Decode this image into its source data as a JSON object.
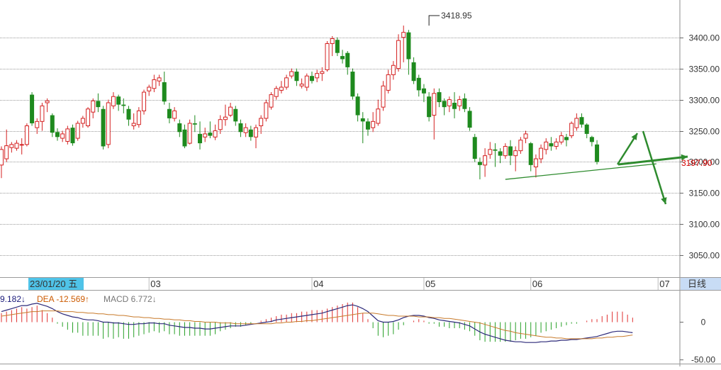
{
  "chart_data": {
    "type": "candlestick",
    "y_axis": {
      "ylim": [
        3015,
        3460
      ],
      "ticks": [
        3050,
        3100,
        3150,
        3200,
        3250,
        3300,
        3350,
        3400
      ],
      "tick_labels": [
        "3050.00",
        "3100.00",
        "3150.00",
        "3200.00",
        "3250.00",
        "3300.00",
        "3350.00",
        "3400.00"
      ]
    },
    "x_axis": {
      "labels": [
        {
          "text": "03",
          "bar": 29
        },
        {
          "text": "04",
          "bar": 61
        },
        {
          "text": "05",
          "bar": 83
        },
        {
          "text": "06",
          "bar": 104
        },
        {
          "text": "07",
          "bar": 129
        }
      ],
      "selected_date": "23/01/20 五",
      "period_label": "日线"
    },
    "annotations": {
      "high_label": "3418.95",
      "high_value": 3418.95,
      "high_bar": 84,
      "current_price": "3197.90",
      "current_value": 3197.9
    },
    "candles": [
      {
        "o": 3195,
        "c": 3220,
        "h": 3225,
        "l": 3174
      },
      {
        "o": 3205,
        "c": 3226,
        "h": 3252,
        "l": 3200
      },
      {
        "o": 3223,
        "c": 3228,
        "h": 3232,
        "l": 3215
      },
      {
        "o": 3222,
        "c": 3230,
        "h": 3235,
        "l": 3218
      },
      {
        "o": 3228,
        "c": 3228,
        "h": 3238,
        "l": 3212
      },
      {
        "o": 3228,
        "c": 3258,
        "h": 3262,
        "l": 3225
      },
      {
        "o": 3308,
        "c": 3262,
        "h": 3312,
        "l": 3258
      },
      {
        "o": 3255,
        "c": 3265,
        "h": 3270,
        "l": 3245
      },
      {
        "o": 3265,
        "c": 3290,
        "h": 3295,
        "l": 3250
      },
      {
        "o": 3295,
        "c": 3298,
        "h": 3302,
        "l": 3280
      },
      {
        "o": 3275,
        "c": 3247,
        "h": 3278,
        "l": 3240
      },
      {
        "o": 3248,
        "c": 3240,
        "h": 3254,
        "l": 3234
      },
      {
        "o": 3238,
        "c": 3245,
        "h": 3250,
        "l": 3232
      },
      {
        "o": 3233,
        "c": 3253,
        "h": 3258,
        "l": 3228
      },
      {
        "o": 3255,
        "c": 3230,
        "h": 3260,
        "l": 3226
      },
      {
        "o": 3238,
        "c": 3262,
        "h": 3266,
        "l": 3234
      },
      {
        "o": 3262,
        "c": 3270,
        "h": 3274,
        "l": 3255
      },
      {
        "o": 3258,
        "c": 3285,
        "h": 3288,
        "l": 3255
      },
      {
        "o": 3280,
        "c": 3298,
        "h": 3302,
        "l": 3270
      },
      {
        "o": 3298,
        "c": 3288,
        "h": 3310,
        "l": 3280
      },
      {
        "o": 3285,
        "c": 3225,
        "h": 3290,
        "l": 3220
      },
      {
        "o": 3228,
        "c": 3295,
        "h": 3300,
        "l": 3222
      },
      {
        "o": 3290,
        "c": 3305,
        "h": 3312,
        "l": 3285
      },
      {
        "o": 3305,
        "c": 3292,
        "h": 3308,
        "l": 3282
      },
      {
        "o": 3292,
        "c": 3290,
        "h": 3302,
        "l": 3278
      },
      {
        "o": 3285,
        "c": 3268,
        "h": 3290,
        "l": 3258
      },
      {
        "o": 3258,
        "c": 3262,
        "h": 3278,
        "l": 3252
      },
      {
        "o": 3260,
        "c": 3282,
        "h": 3288,
        "l": 3255
      },
      {
        "o": 3282,
        "c": 3312,
        "h": 3316,
        "l": 3276
      },
      {
        "o": 3314,
        "c": 3320,
        "h": 3324,
        "l": 3306
      },
      {
        "o": 3318,
        "c": 3332,
        "h": 3340,
        "l": 3312
      },
      {
        "o": 3330,
        "c": 3335,
        "h": 3340,
        "l": 3322
      },
      {
        "o": 3328,
        "c": 3297,
        "h": 3345,
        "l": 3292
      },
      {
        "o": 3285,
        "c": 3270,
        "h": 3295,
        "l": 3262
      },
      {
        "o": 3270,
        "c": 3282,
        "h": 3288,
        "l": 3265
      },
      {
        "o": 3262,
        "c": 3248,
        "h": 3268,
        "l": 3240
      },
      {
        "o": 3252,
        "c": 3225,
        "h": 3260,
        "l": 3222
      },
      {
        "o": 3230,
        "c": 3262,
        "h": 3268,
        "l": 3228
      },
      {
        "o": 3262,
        "c": 3260,
        "h": 3275,
        "l": 3248
      },
      {
        "o": 3245,
        "c": 3230,
        "h": 3265,
        "l": 3220
      },
      {
        "o": 3240,
        "c": 3245,
        "h": 3255,
        "l": 3232
      },
      {
        "o": 3247,
        "c": 3242,
        "h": 3265,
        "l": 3238
      },
      {
        "o": 3240,
        "c": 3250,
        "h": 3260,
        "l": 3235
      },
      {
        "o": 3252,
        "c": 3268,
        "h": 3275,
        "l": 3245
      },
      {
        "o": 3268,
        "c": 3272,
        "h": 3292,
        "l": 3258
      },
      {
        "o": 3275,
        "c": 3288,
        "h": 3295,
        "l": 3272
      },
      {
        "o": 3285,
        "c": 3265,
        "h": 3290,
        "l": 3258
      },
      {
        "o": 3262,
        "c": 3248,
        "h": 3268,
        "l": 3240
      },
      {
        "o": 3247,
        "c": 3255,
        "h": 3262,
        "l": 3240
      },
      {
        "o": 3252,
        "c": 3240,
        "h": 3258,
        "l": 3234
      },
      {
        "o": 3240,
        "c": 3255,
        "h": 3260,
        "l": 3222
      },
      {
        "o": 3258,
        "c": 3270,
        "h": 3275,
        "l": 3245
      },
      {
        "o": 3270,
        "c": 3295,
        "h": 3300,
        "l": 3265
      },
      {
        "o": 3288,
        "c": 3308,
        "h": 3312,
        "l": 3284
      },
      {
        "o": 3305,
        "c": 3318,
        "h": 3322,
        "l": 3300
      },
      {
        "o": 3315,
        "c": 3320,
        "h": 3330,
        "l": 3310
      },
      {
        "o": 3320,
        "c": 3335,
        "h": 3340,
        "l": 3316
      },
      {
        "o": 3338,
        "c": 3345,
        "h": 3350,
        "l": 3334
      },
      {
        "o": 3345,
        "c": 3330,
        "h": 3350,
        "l": 3322
      },
      {
        "o": 3322,
        "c": 3325,
        "h": 3334,
        "l": 3318
      },
      {
        "o": 3320,
        "c": 3338,
        "h": 3342,
        "l": 3314
      },
      {
        "o": 3338,
        "c": 3330,
        "h": 3345,
        "l": 3326
      },
      {
        "o": 3335,
        "c": 3342,
        "h": 3348,
        "l": 3328
      },
      {
        "o": 3342,
        "c": 3345,
        "h": 3352,
        "l": 3330
      },
      {
        "o": 3348,
        "c": 3390,
        "h": 3394,
        "l": 3345
      },
      {
        "o": 3390,
        "c": 3398,
        "h": 3402,
        "l": 3370
      },
      {
        "o": 3396,
        "c": 3375,
        "h": 3400,
        "l": 3370
      },
      {
        "o": 3370,
        "c": 3365,
        "h": 3380,
        "l": 3358
      },
      {
        "o": 3375,
        "c": 3352,
        "h": 3378,
        "l": 3340
      },
      {
        "o": 3345,
        "c": 3305,
        "h": 3350,
        "l": 3300
      },
      {
        "o": 3305,
        "c": 3275,
        "h": 3310,
        "l": 3265
      },
      {
        "o": 3270,
        "c": 3265,
        "h": 3280,
        "l": 3230
      },
      {
        "o": 3265,
        "c": 3252,
        "h": 3270,
        "l": 3242
      },
      {
        "o": 3255,
        "c": 3265,
        "h": 3280,
        "l": 3248
      },
      {
        "o": 3262,
        "c": 3285,
        "h": 3300,
        "l": 3258
      },
      {
        "o": 3288,
        "c": 3322,
        "h": 3330,
        "l": 3282
      },
      {
        "o": 3315,
        "c": 3340,
        "h": 3348,
        "l": 3310
      },
      {
        "o": 3340,
        "c": 3355,
        "h": 3362,
        "l": 3332
      },
      {
        "o": 3350,
        "c": 3395,
        "h": 3405,
        "l": 3345
      },
      {
        "o": 3400,
        "c": 3408,
        "h": 3418.95,
        "l": 3360
      },
      {
        "o": 3408,
        "c": 3365,
        "h": 3412,
        "l": 3340
      },
      {
        "o": 3360,
        "c": 3330,
        "h": 3368,
        "l": 3325
      },
      {
        "o": 3335,
        "c": 3315,
        "h": 3340,
        "l": 3305
      },
      {
        "o": 3318,
        "c": 3310,
        "h": 3325,
        "l": 3296
      },
      {
        "o": 3305,
        "c": 3272,
        "h": 3312,
        "l": 3265
      },
      {
        "o": 3275,
        "c": 3310,
        "h": 3318,
        "l": 3236
      },
      {
        "o": 3312,
        "c": 3296,
        "h": 3318,
        "l": 3288
      },
      {
        "o": 3298,
        "c": 3288,
        "h": 3302,
        "l": 3275
      },
      {
        "o": 3290,
        "c": 3300,
        "h": 3305,
        "l": 3280
      },
      {
        "o": 3295,
        "c": 3285,
        "h": 3312,
        "l": 3270
      },
      {
        "o": 3290,
        "c": 3300,
        "h": 3306,
        "l": 3282
      },
      {
        "o": 3302,
        "c": 3285,
        "h": 3310,
        "l": 3280
      },
      {
        "o": 3282,
        "c": 3255,
        "h": 3288,
        "l": 3250
      },
      {
        "o": 3240,
        "c": 3205,
        "h": 3245,
        "l": 3200
      },
      {
        "o": 3200,
        "c": 3195,
        "h": 3207,
        "l": 3172
      },
      {
        "o": 3195,
        "c": 3210,
        "h": 3222,
        "l": 3176
      },
      {
        "o": 3212,
        "c": 3220,
        "h": 3232,
        "l": 3205
      },
      {
        "o": 3220,
        "c": 3218,
        "h": 3230,
        "l": 3192
      },
      {
        "o": 3217,
        "c": 3210,
        "h": 3222,
        "l": 3198
      },
      {
        "o": 3210,
        "c": 3225,
        "h": 3230,
        "l": 3205
      },
      {
        "o": 3225,
        "c": 3210,
        "h": 3235,
        "l": 3195
      },
      {
        "o": 3210,
        "c": 3218,
        "h": 3225,
        "l": 3185
      },
      {
        "o": 3218,
        "c": 3235,
        "h": 3240,
        "l": 3213
      },
      {
        "o": 3238,
        "c": 3245,
        "h": 3250,
        "l": 3230
      },
      {
        "o": 3230,
        "c": 3195,
        "h": 3232,
        "l": 3185
      },
      {
        "o": 3192,
        "c": 3205,
        "h": 3212,
        "l": 3175
      },
      {
        "o": 3205,
        "c": 3222,
        "h": 3228,
        "l": 3198
      },
      {
        "o": 3220,
        "c": 3232,
        "h": 3238,
        "l": 3212
      },
      {
        "o": 3230,
        "c": 3225,
        "h": 3240,
        "l": 3218
      },
      {
        "o": 3225,
        "c": 3232,
        "h": 3238,
        "l": 3220
      },
      {
        "o": 3232,
        "c": 3242,
        "h": 3248,
        "l": 3228
      },
      {
        "o": 3240,
        "c": 3235,
        "h": 3245,
        "l": 3225
      },
      {
        "o": 3242,
        "c": 3262,
        "h": 3265,
        "l": 3238
      },
      {
        "o": 3255,
        "c": 3270,
        "h": 3278,
        "l": 3250
      },
      {
        "o": 3272,
        "c": 3260,
        "h": 3278,
        "l": 3255
      },
      {
        "o": 3260,
        "c": 3245,
        "h": 3262,
        "l": 3238
      },
      {
        "o": 3240,
        "c": 3232,
        "h": 3242,
        "l": 3225
      },
      {
        "o": 3228,
        "c": 3200,
        "h": 3235,
        "l": 3196
      }
    ],
    "trendline": {
      "from": [
        99,
        3172
      ],
      "to": [
        127,
        3197
      ]
    },
    "macd": {
      "legend": {
        "dif": "9.182↓",
        "dea": "DEA -12.569↑",
        "macd": "MACD 6.772↓"
      },
      "ylim": [
        -55,
        40
      ],
      "ticks": [
        0,
        -50
      ],
      "tick_labels": [
        "0",
        "-50.00"
      ],
      "dif": [
        14,
        16,
        18,
        20,
        22,
        22,
        24,
        25,
        23,
        21,
        18,
        14,
        11,
        9,
        7,
        6,
        4,
        3,
        3,
        2,
        0,
        0,
        -1,
        -1,
        -2,
        -3,
        -3,
        -2,
        -2,
        -1,
        -1,
        -2,
        -2,
        -4,
        -5,
        -6,
        -7,
        -7,
        -8,
        -8,
        -9,
        -9,
        -8,
        -7,
        -6,
        -5,
        -5,
        -5,
        -4,
        -3,
        -2,
        -1,
        0,
        1,
        3,
        4,
        5,
        6,
        7,
        8,
        9,
        10,
        11,
        12,
        14,
        16,
        18,
        20,
        22,
        23,
        21,
        18,
        14,
        8,
        2,
        0,
        0,
        1,
        3,
        6,
        8,
        9,
        9,
        8,
        6,
        5,
        3,
        2,
        1,
        0,
        -1,
        -3,
        -5,
        -9,
        -13,
        -16,
        -18,
        -20,
        -22,
        -24,
        -25,
        -26,
        -26,
        -27,
        -27,
        -27,
        -26,
        -26,
        -25,
        -25,
        -24,
        -24,
        -23,
        -23,
        -22,
        -21,
        -20,
        -19,
        -17,
        -15,
        -13,
        -12,
        -12,
        -13,
        -14
      ],
      "dea": [
        8,
        9,
        10,
        11,
        12,
        13,
        14,
        14,
        15,
        15,
        15,
        15,
        14,
        14,
        14,
        13,
        13,
        12,
        12,
        11,
        11,
        10,
        10,
        9,
        9,
        8,
        7,
        7,
        6,
        6,
        5,
        5,
        4,
        4,
        3,
        3,
        2,
        2,
        1,
        1,
        0,
        0,
        0,
        -1,
        -1,
        -1,
        -2,
        -2,
        -2,
        -2,
        -2,
        -2,
        -2,
        -2,
        -1,
        -1,
        0,
        0,
        1,
        1,
        2,
        2,
        3,
        4,
        5,
        6,
        7,
        8,
        9,
        10,
        11,
        12,
        12,
        12,
        11,
        10,
        9,
        9,
        8,
        8,
        8,
        8,
        7,
        7,
        7,
        6,
        6,
        5,
        5,
        4,
        3,
        2,
        1,
        0,
        -1,
        -3,
        -5,
        -7,
        -9,
        -11,
        -12,
        -14,
        -15,
        -16,
        -17,
        -18,
        -19,
        -20,
        -20,
        -21,
        -21,
        -22,
        -22,
        -22,
        -22,
        -22,
        -22,
        -21,
        -21,
        -20,
        -20,
        -19,
        -19,
        -18,
        -17
      ]
    }
  }
}
